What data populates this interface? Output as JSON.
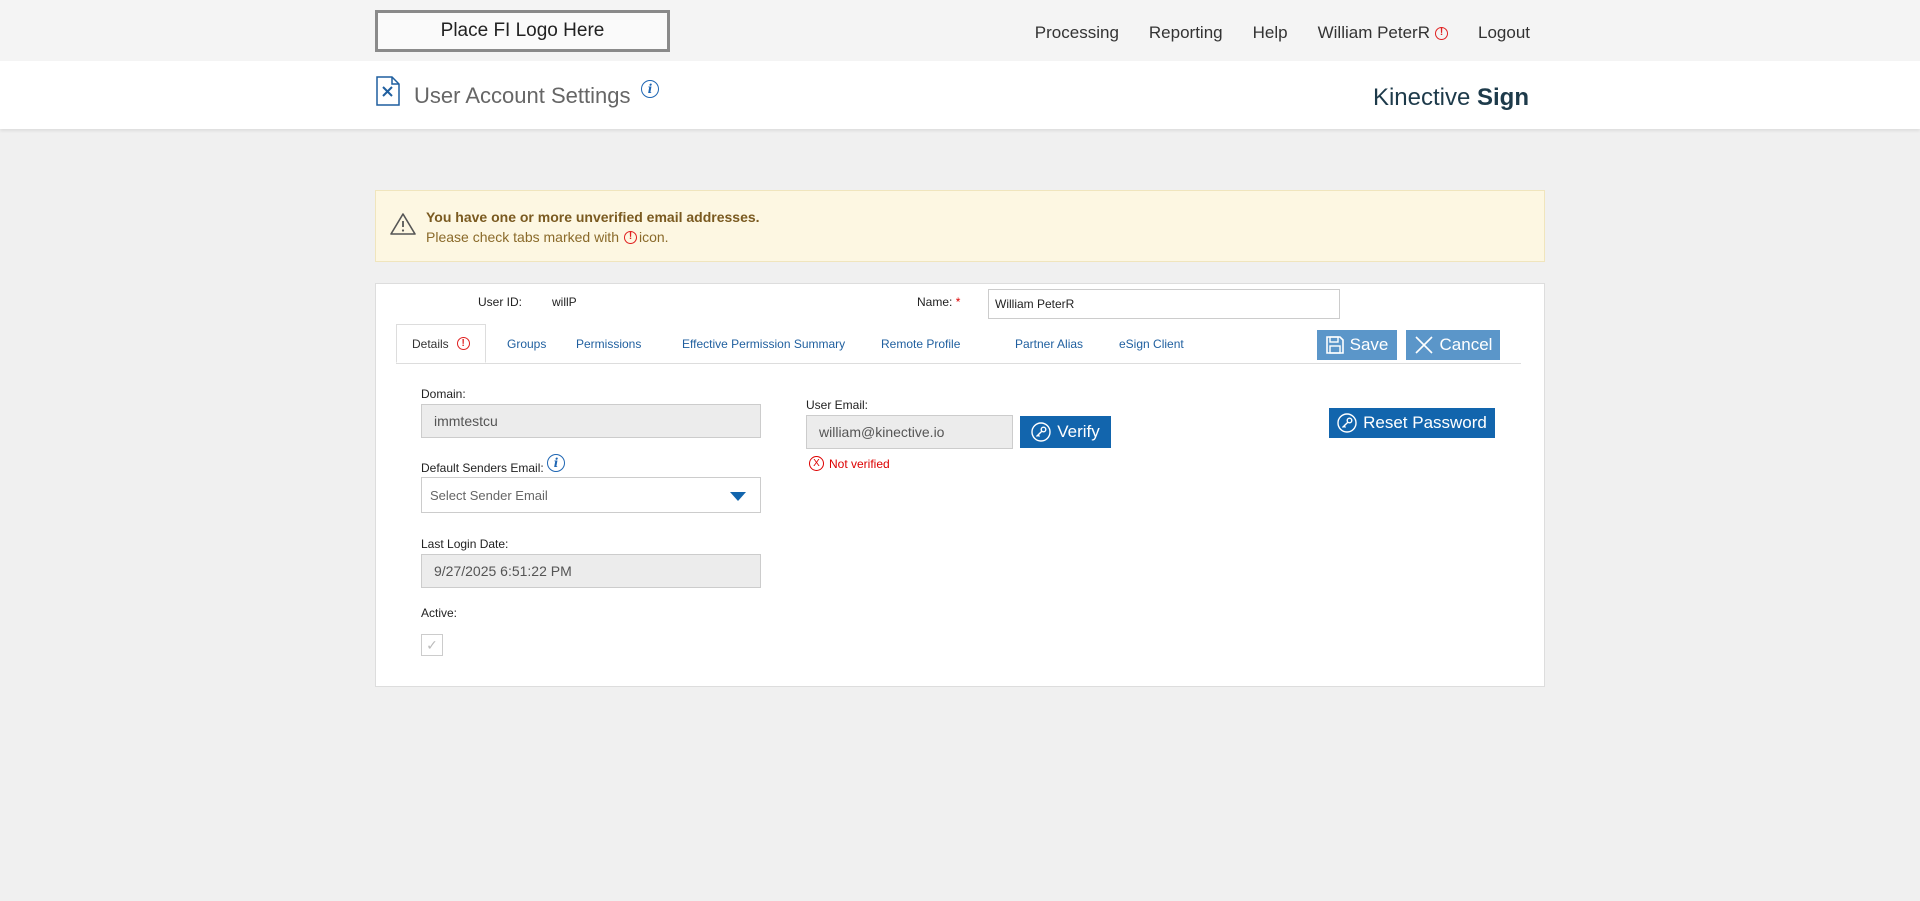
{
  "header": {
    "logo_placeholder": "Place FI Logo Here",
    "nav": {
      "processing": "Processing",
      "reporting": "Reporting",
      "help": "Help",
      "user": "William PeterR",
      "logout": "Logout"
    }
  },
  "titlebar": {
    "title": "User Account Settings",
    "brand_regular": "Kinective",
    "brand_bold": "Sign"
  },
  "warning": {
    "title": "You have one or more unverified email addresses.",
    "message_before": "Please check tabs marked with",
    "message_after": "icon."
  },
  "form": {
    "user_id_label": "User ID:",
    "user_id_value": "willP",
    "name_label": "Name:",
    "name_required": "*",
    "name_value": "William PeterR",
    "save_label": "Save",
    "cancel_label": "Cancel",
    "tabs": {
      "details": "Details",
      "groups": "Groups",
      "permissions": "Permissions",
      "effective": "Effective Permission Summary",
      "remote": "Remote Profile",
      "partner": "Partner Alias",
      "esign": "eSign Client"
    },
    "domain_label": "Domain:",
    "domain_value": "immtestcu",
    "default_sender_label": "Default Senders Email:",
    "default_sender_placeholder": "Select Sender Email",
    "last_login_label": "Last Login Date:",
    "last_login_value": "9/27/2025 6:51:22 PM",
    "active_label": "Active:",
    "user_email_label": "User Email:",
    "user_email_value": "william@kinective.io",
    "verify_label": "Verify",
    "not_verified": "Not verified",
    "reset_password_label": "Reset Password"
  }
}
